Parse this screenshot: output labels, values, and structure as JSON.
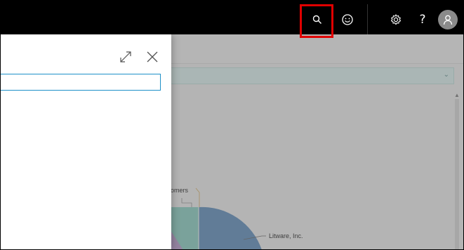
{
  "header": {
    "search_icon": "search-icon",
    "feedback_icon": "smiley-icon",
    "settings_icon": "gear-icon",
    "help_label": "?",
    "user_icon": "person-icon"
  },
  "search_panel": {
    "expand_icon": "expand-icon",
    "close_icon": "close-icon",
    "query": ""
  },
  "background": {
    "chart_labels": {
      "customers_fragment": "omers",
      "litware": "Litware, Inc."
    }
  },
  "colors": {
    "topbar": "#000000",
    "highlight": "#e00000",
    "input_border": "#1e90c8",
    "pie_blue": "#83a8cc",
    "pie_teal": "#a5dbd1",
    "pie_purple": "#c9b3d9"
  }
}
